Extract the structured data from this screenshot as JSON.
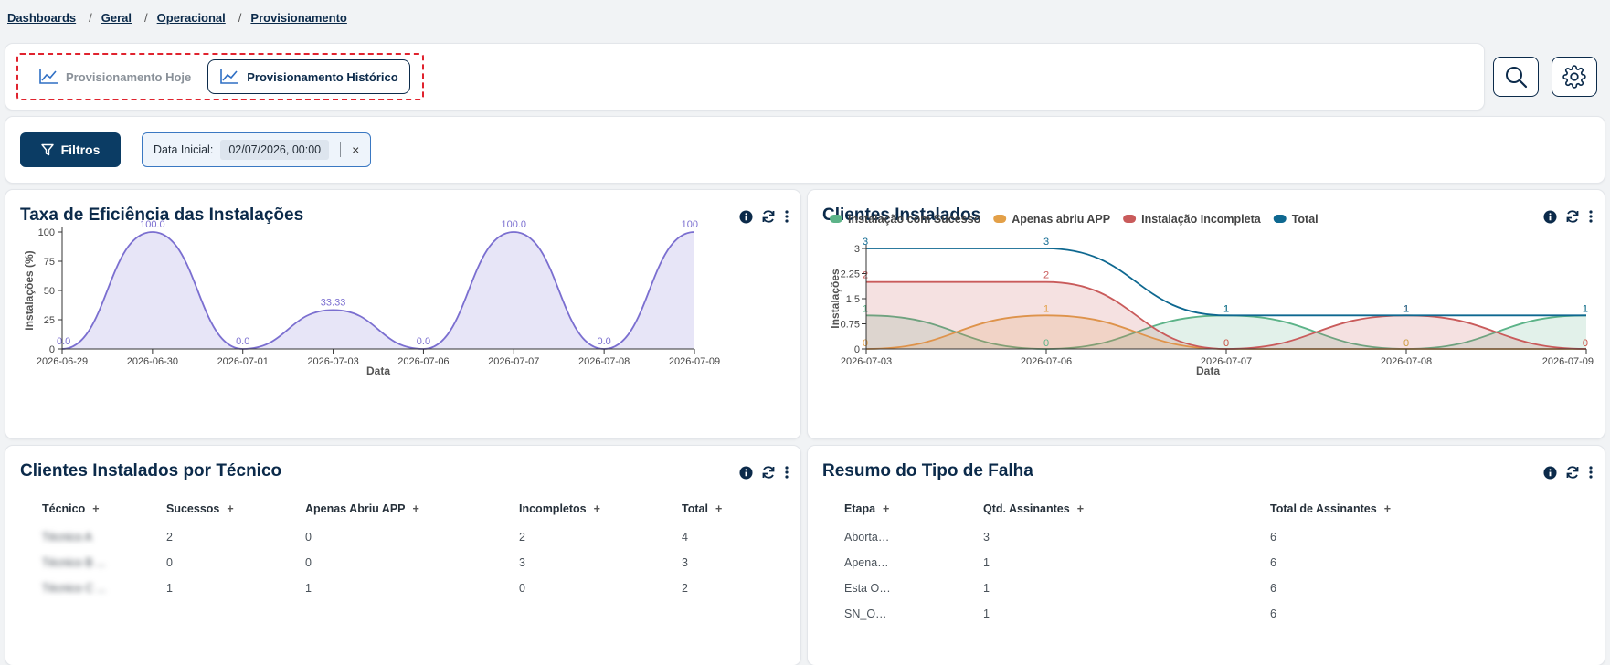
{
  "breadcrumb": [
    "Dashboards",
    "Geral",
    "Operacional",
    "Provisionamento"
  ],
  "tabs": [
    {
      "label": "Provisionamento Hoje",
      "active": false
    },
    {
      "label": "Provisionamento Histórico",
      "active": true
    }
  ],
  "toolbar": {
    "search_icon": "search-icon",
    "settings_icon": "gear-icon"
  },
  "filters": {
    "button_label": "Filtros",
    "chip_label": "Data Inicial:",
    "chip_value": "02/07/2026, 00:00",
    "chip_remove": "×"
  },
  "colors": {
    "primary": "#0b3c64",
    "accent_purple": "#7b6fd0",
    "success": "#5cb388",
    "warning": "#e3a048",
    "danger": "#c95b5b",
    "total": "#0e6890"
  },
  "panels": {
    "efficiency": {
      "title": "Taxa de Eficiência das Instalações"
    },
    "clients": {
      "title": "Clientes Instalados"
    },
    "by_tech": {
      "title": "Clientes Instalados por Técnico",
      "columns": [
        "Técnico",
        "Sucessos",
        "Apenas Abriu APP",
        "Incompletos",
        "Total"
      ],
      "rows": [
        [
          "Técnico A",
          "2",
          "0",
          "2",
          "4"
        ],
        [
          "Técnico B ...",
          "0",
          "0",
          "3",
          "3"
        ],
        [
          "Técnico C ...",
          "1",
          "1",
          "0",
          "2"
        ]
      ]
    },
    "failures": {
      "title": "Resumo do Tipo de Falha",
      "columns": [
        "Etapa",
        "Qtd. Assinantes",
        "Total de Assinantes"
      ],
      "rows": [
        [
          "Aborta…",
          "3",
          "6"
        ],
        [
          "Apena…",
          "1",
          "6"
        ],
        [
          "Esta O…",
          "1",
          "6"
        ],
        [
          "SN_O…",
          "1",
          "6"
        ]
      ]
    }
  },
  "chart_data": [
    {
      "type": "area",
      "title": "Taxa de Eficiência das Instalações",
      "xlabel": "Data",
      "ylabel": "Instalações (%)",
      "ylim": [
        0,
        100
      ],
      "yticks": [
        0,
        25,
        50,
        75,
        100
      ],
      "x": [
        "2026-06-29",
        "2026-06-30",
        "2026-07-01",
        "2026-07-03",
        "2026-07-06",
        "2026-07-07",
        "2026-07-08",
        "2026-07-09"
      ],
      "series": [
        {
          "values": [
            0,
            100,
            0,
            33.33,
            0,
            100,
            0,
            100
          ]
        }
      ],
      "data_labels": [
        "0.0",
        "100.0",
        "0.0",
        "33.33",
        "0.0",
        "100.0",
        "0.0",
        "100"
      ],
      "color": "#7b6fd0",
      "grid": false
    },
    {
      "type": "area",
      "title": "Clientes Instalados",
      "xlabel": "Data",
      "ylabel": "Instalações",
      "ylim": [
        0,
        3
      ],
      "yticks": [
        "0",
        "0.75",
        "1.5",
        "2.25",
        "3"
      ],
      "x": [
        "2026-07-03",
        "2026-07-06",
        "2026-07-07",
        "2026-07-08",
        "2026-07-09"
      ],
      "legend": "top-left",
      "series": [
        {
          "name": "Instalação com Sucesso",
          "values": [
            1,
            0,
            1,
            0,
            1
          ],
          "color": "#5cb388"
        },
        {
          "name": "Apenas abriu APP",
          "values": [
            0,
            1,
            0,
            0,
            0
          ],
          "color": "#e3a048"
        },
        {
          "name": "Instalação Incompleta",
          "values": [
            2,
            2,
            0,
            1,
            0
          ],
          "color": "#c95b5b"
        },
        {
          "name": "Total",
          "values": [
            3,
            3,
            1,
            1,
            1
          ],
          "color": "#0e6890"
        }
      ],
      "grid": false
    }
  ]
}
